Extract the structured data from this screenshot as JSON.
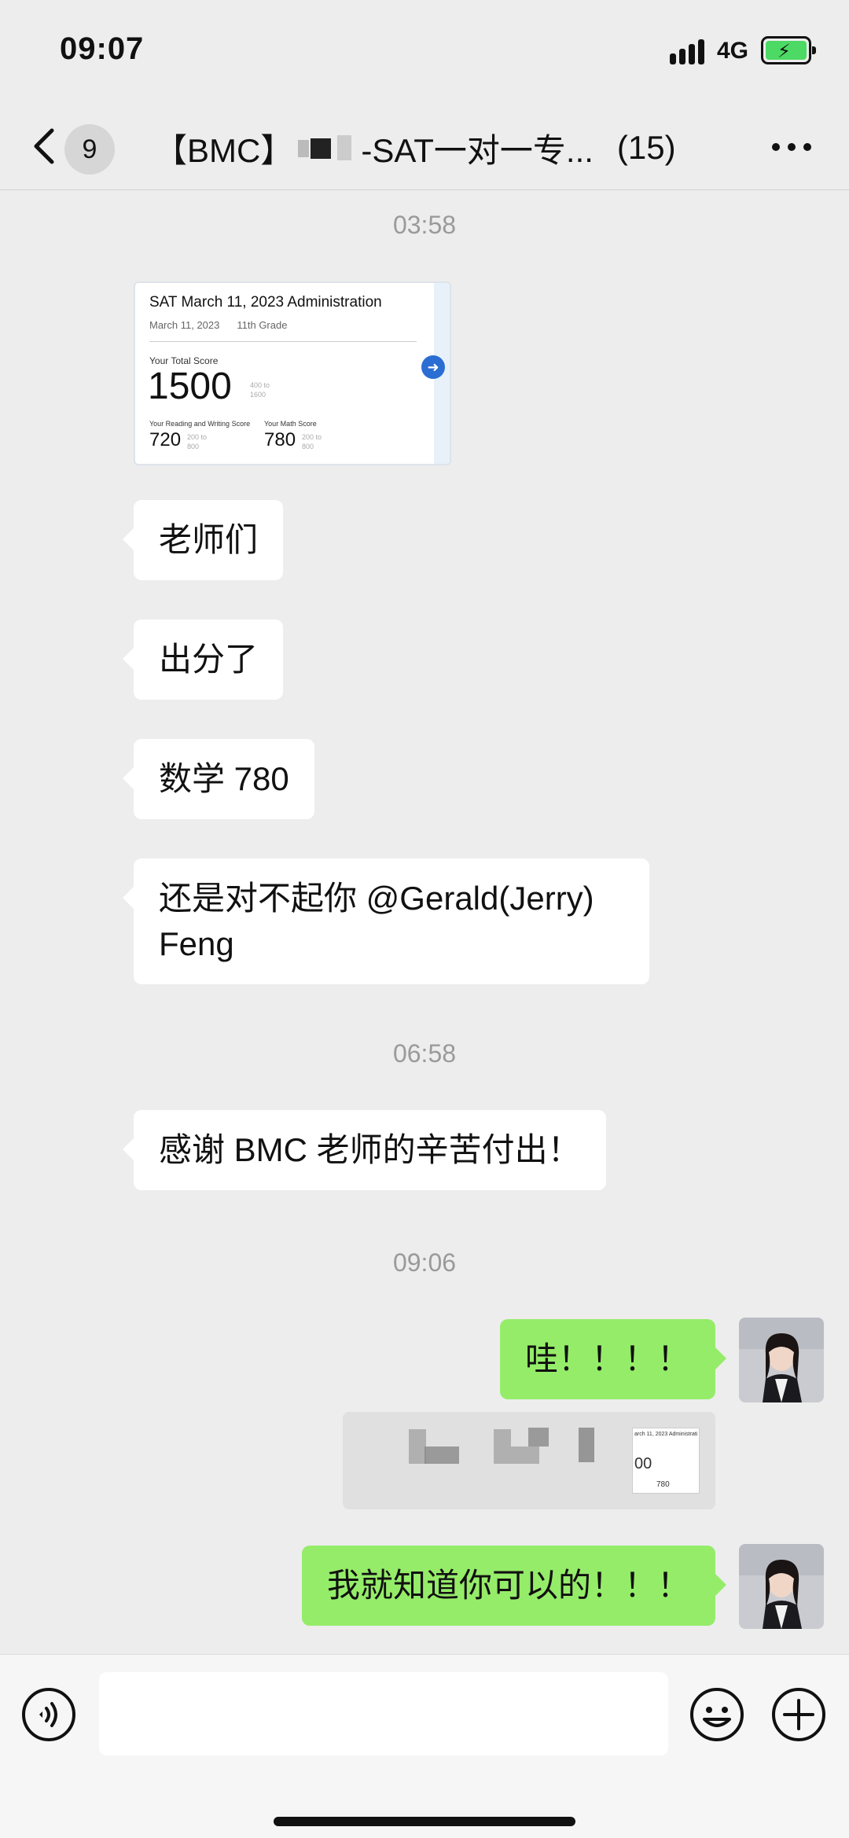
{
  "status_bar": {
    "time": "09:07",
    "network": "4G"
  },
  "header": {
    "back_badge": "9",
    "title_prefix": "【BMC】",
    "title_suffix": "-SAT一对一专...",
    "member_count": "(15)"
  },
  "messages": {
    "ts1": "03:58",
    "score_card": {
      "title": "SAT March 11, 2023 Administration",
      "date": "March 11, 2023",
      "grade": "11th Grade",
      "total_label": "Your Total Score",
      "total": "1500",
      "total_range": "400 to 1600",
      "rw_label": "Your Reading and Writing Score",
      "rw_score": "720",
      "rw_range": "200 to 800",
      "math_label": "Your Math Score",
      "math_score": "780",
      "math_range": "200 to 800"
    },
    "m1": "老师们",
    "m2": "出分了",
    "m3": "数学 780",
    "m4": "还是对不起你 @Gerald(Jerry) Feng",
    "ts2": "06:58",
    "m5": "感谢 BMC 老师的辛苦付出！",
    "ts3": "09:06",
    "m6": "哇！！！！",
    "quote_thumb": {
      "title": "arch 11, 2023 Administrati",
      "score": "00",
      "math": "780"
    },
    "m7": "我就知道你可以的！！！"
  },
  "input": {
    "placeholder": ""
  },
  "colors": {
    "background": "#ededed",
    "sent_bubble": "#95ec69",
    "received_bubble": "#ffffff",
    "link_arrow": "#2a6ed3"
  },
  "icons": [
    "chevron-left-icon",
    "more-icon",
    "voice-icon",
    "emoji-icon",
    "add-icon",
    "arrow-right-icon"
  ]
}
